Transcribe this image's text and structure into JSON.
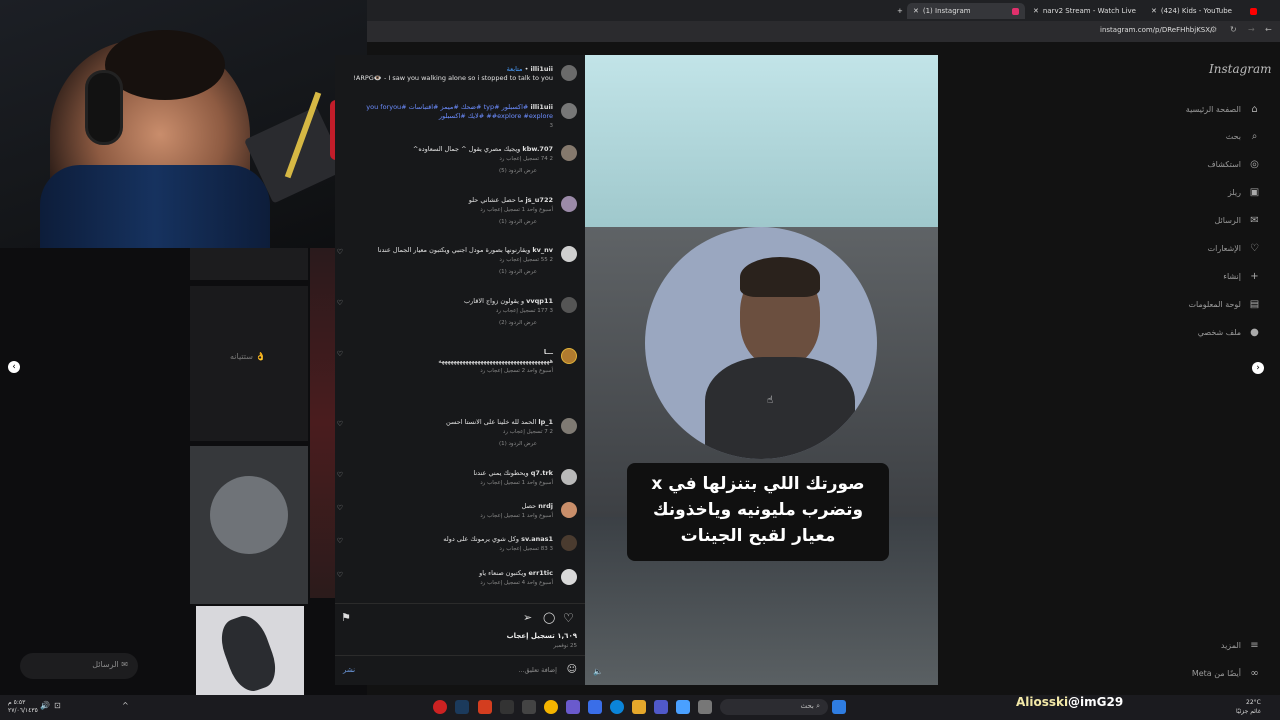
{
  "browser": {
    "tabs": [
      {
        "label": "(1) Instagram"
      },
      {
        "label": "narv2 Stream - Watch Live"
      },
      {
        "label": "(424) Kids - YouTube"
      }
    ],
    "url": "instagram.com/p/DReFHhbjKSX/"
  },
  "sidebar": {
    "logo": "Instagram",
    "items": [
      {
        "label": "الصفحة الرئيسية",
        "icon": "home-icon"
      },
      {
        "label": "بحث",
        "icon": "search-icon"
      },
      {
        "label": "استكشاف",
        "icon": "compass-icon"
      },
      {
        "label": "ريلز",
        "icon": "reels-icon"
      },
      {
        "label": "الرسائل",
        "icon": "messenger-icon"
      },
      {
        "label": "الإشعارات",
        "icon": "heart-icon"
      },
      {
        "label": "إنشاء",
        "icon": "plus-icon"
      },
      {
        "label": "لوحة المعلومات",
        "icon": "dashboard-icon"
      },
      {
        "label": "ملف شخصي",
        "icon": "avatar-icon"
      }
    ],
    "more": "المزيد",
    "also_from_meta": "أيضًا من Meta"
  },
  "post": {
    "overlay_text": [
      "صورتك اللي بتنزلها في x",
      "وتضرب مليونيه وياخذونك",
      "معيار لقبح الجينات"
    ],
    "likes": "١,٦٠٩ تسجيل إعجاب",
    "date": "25 نوفمبر",
    "add_comment_placeholder": "إضافة تعليق...",
    "post_label": "نشر"
  },
  "comments": [
    {
      "user": "illi1uii",
      "follow": "متابعة",
      "text": "ARPG👁️ - I saw you walking alone so i stopped to talk to you!",
      "meta": ""
    },
    {
      "user": "illi1uii",
      "text": "#اكسبلور #typ #ضحك #ميمز #اقتباسات #you foryou #explore #explore# #لايك #اكسبلور",
      "meta": "3"
    },
    {
      "user": "kbw.707",
      "text": "ويجيك مصري يقول ^ جمال السعاوده^",
      "meta": "2   74 تسجيل إعجاب   رد",
      "replies": "عرض الردود (5)"
    },
    {
      "user": "js_u722",
      "text": "ما حصل عشاني حلو",
      "meta": "أسبوع واحد   1 تسجيل إعجاب   رد",
      "replies": "عرض الردود (1)"
    },
    {
      "user": "kv_nv",
      "text": "ويقارنونها بصورة مودل اجنبي ويكتبون معيار الجمال عندنا",
      "meta": "2   55 تسجيل إعجاب   رد",
      "replies": "عرض الردود (1)"
    },
    {
      "user": "vvqp11",
      "text": "و يقولون زواج الاقارب",
      "meta": "3   177 تسجيل إعجاب   رد",
      "replies": "عرض الردود (2)"
    },
    {
      "user": "ـــا",
      "text": "هههههههههههههههههههههههههههههههههههههه",
      "meta": "أسبوع واحد   2 تسجيل إعجاب   رد"
    },
    {
      "user": "lp_1",
      "text": "الحمد لله خلينا على الانستا احسن",
      "meta": "2   7 تسجيل إعجاب   رد",
      "replies": "عرض الردود (1)"
    },
    {
      "user": "q7.trk",
      "text": "ويحطونك يمني عندنا",
      "meta": "أسبوع واحد   1 تسجيل إعجاب   رد"
    },
    {
      "user": "nrdj",
      "text": "حصل",
      "meta": "أسبوع واحد   1 تسجيل إعجاب   رد"
    },
    {
      "user": "sv.anas1",
      "text": "وكل شوي يرمونك على دوله",
      "meta": "3   83 تسجيل إعجاب   رد"
    },
    {
      "user": "err1tic",
      "text": "ويكتبون صنعاء ياو",
      "meta": "أسبوع واحد   4 تسجيل إعجاب   رد"
    }
  ],
  "left_bg": {
    "caption": "ستتيانه 👌",
    "side_messages": "الرسائل"
  },
  "overlay": {
    "streamer_name": "Aliosski",
    "handle": "@imG29"
  },
  "taskbar": {
    "search": "بحث",
    "weather": "22°C",
    "weather_sub": "غائم جزئيًا",
    "time": "٥:٥٣ م",
    "date": "٢٧/٠٦/١٤٣٥"
  }
}
